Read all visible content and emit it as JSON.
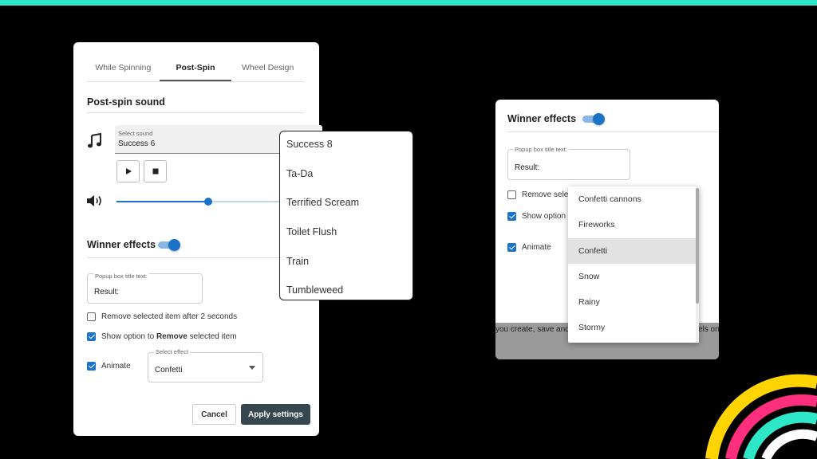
{
  "tabs": [
    {
      "label": "While Spinning"
    },
    {
      "label": "Post-Spin"
    },
    {
      "label": "Wheel Design"
    }
  ],
  "post_spin": {
    "section_title": "Post-spin sound",
    "sound_field": {
      "label": "Select sound",
      "value": "Success 6"
    },
    "volume_fraction": 0.45
  },
  "sound_options": [
    "Success 8",
    "Ta-Da",
    "Terrified Scream",
    "Toilet Flush",
    "Train",
    "Tumbleweed"
  ],
  "winner_effects": {
    "title": "Winner effects",
    "popup_title": {
      "label": "Popup box title text:",
      "value": "Result:"
    },
    "remove_after": {
      "label": "Remove selected item after 2 seconds",
      "checked": false
    },
    "show_option": {
      "prefix": "Show option to ",
      "bold": "Remove",
      "suffix": " selected item",
      "checked": true
    },
    "animate": {
      "label": "Animate",
      "checked": true
    },
    "effect_field": {
      "label": "Select effect",
      "value": "Confetti"
    }
  },
  "buttons": {
    "cancel": "Cancel",
    "apply": "Apply settings"
  },
  "right_panel": {
    "title": "Winner effects",
    "popup_title": {
      "label": "Popup box title text:",
      "value": "Result:"
    },
    "remove_partial": "Remove sele",
    "show_partial": "Show option",
    "animate": "Animate",
    "band_text": "you create, save and",
    "band_text_right": "els on"
  },
  "effect_options": [
    {
      "label": "Confetti cannons"
    },
    {
      "label": "Fireworks"
    },
    {
      "label": "Confetti",
      "selected": true
    },
    {
      "label": "Snow"
    },
    {
      "label": "Rainy"
    },
    {
      "label": "Stormy"
    }
  ],
  "colors": {
    "accent": "#1a73c8",
    "apply_button": "#37474f",
    "stripe": "#2ee6c8"
  }
}
